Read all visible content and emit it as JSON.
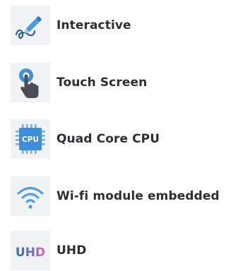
{
  "features": [
    {
      "label": "Interactive",
      "icon": "pen-icon"
    },
    {
      "label": "Touch Screen",
      "icon": "touch-hand-icon"
    },
    {
      "label": "Quad Core CPU",
      "icon": "cpu-chip-icon",
      "icon_text": "CPU"
    },
    {
      "label": "Wi-fi module embedded",
      "icon": "wifi-icon"
    },
    {
      "label": "UHD",
      "icon": "uhd-icon",
      "icon_text": "UHD"
    }
  ],
  "colors": {
    "icon_bg": "#f1f2f3",
    "label_text": "#2d2f33",
    "accent_blue": "#3d8fd9",
    "accent_dark": "#2f5dab",
    "uhd_blue": "#2f6fc1",
    "uhd_pink": "#e46a9f"
  }
}
